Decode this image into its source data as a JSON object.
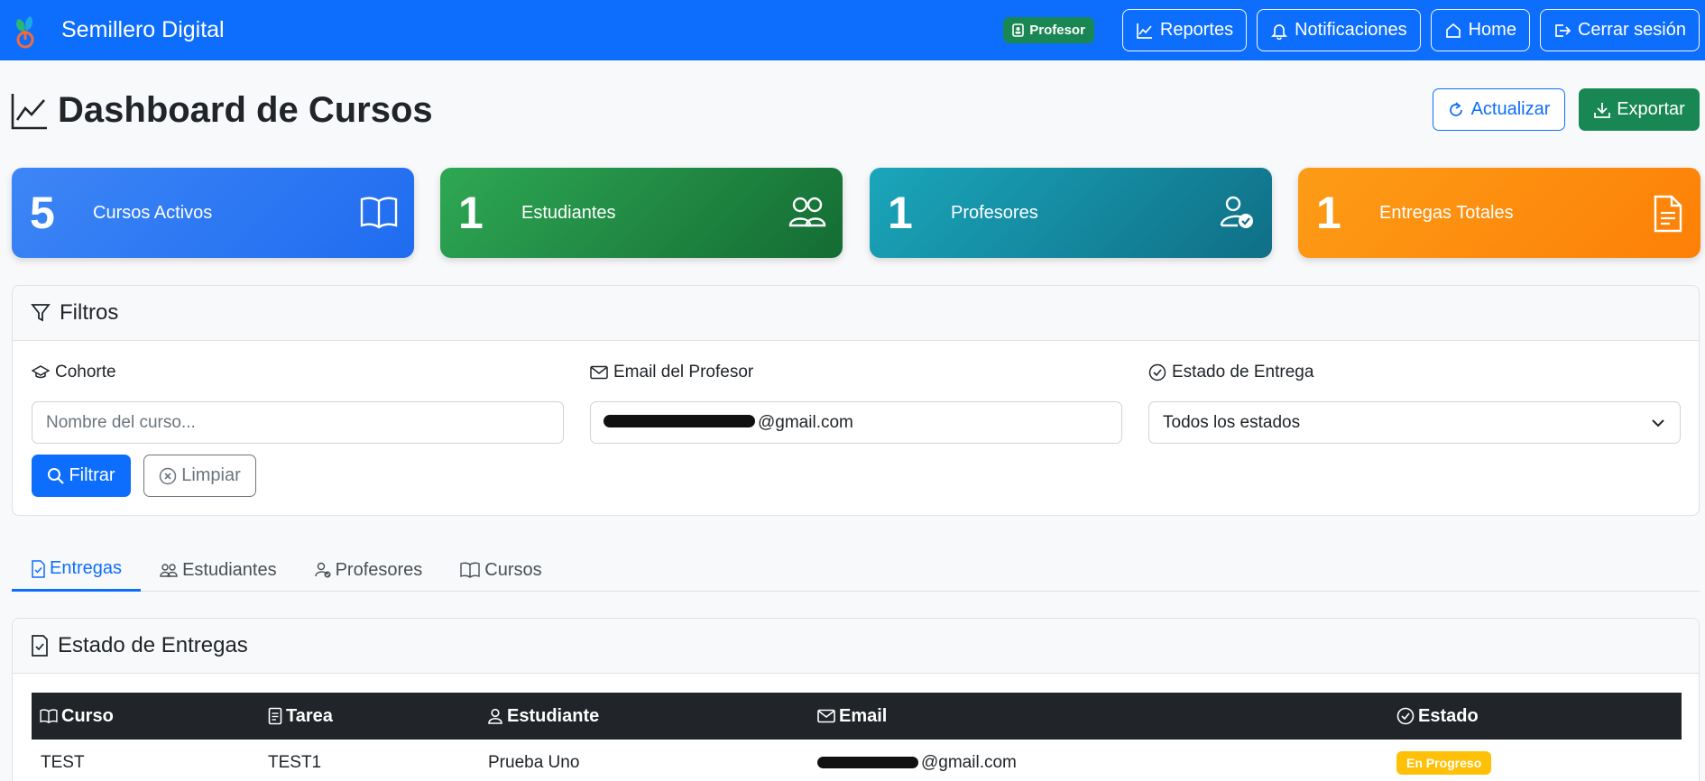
{
  "navbar": {
    "brand": "Semillero Digital",
    "role_badge": "Profesor",
    "links": [
      "Reportes",
      "Notificaciones",
      "Home",
      "Cerrar sesión"
    ]
  },
  "header": {
    "title": "Dashboard de Cursos",
    "refresh_label": "Actualizar",
    "export_label": "Exportar"
  },
  "stats": [
    {
      "value": "5",
      "label": "Cursos Activos",
      "icon": "book-icon",
      "color": "#3d86f6"
    },
    {
      "value": "1",
      "label": "Estudiantes",
      "icon": "people-icon",
      "color": "#2ea854"
    },
    {
      "value": "1",
      "label": "Profesores",
      "icon": "person-check-icon",
      "color": "#1aa6bb"
    },
    {
      "value": "1",
      "label": "Entregas Totales",
      "icon": "document-icon",
      "color": "#fd8f0f"
    }
  ],
  "filters": {
    "title": "Filtros",
    "cohorte": {
      "label": "Cohorte",
      "placeholder": "Nombre del curso..."
    },
    "email": {
      "label": "Email del Profesor",
      "value": "@gmail.com"
    },
    "estado": {
      "label": "Estado de Entrega",
      "selected": "Todos los estados"
    },
    "filter_label": "Filtrar",
    "clear_label": "Limpiar"
  },
  "tabs": [
    {
      "label": "Entregas",
      "active": true
    },
    {
      "label": "Estudiantes",
      "active": false
    },
    {
      "label": "Profesores",
      "active": false
    },
    {
      "label": "Cursos",
      "active": false
    }
  ],
  "entregas": {
    "title": "Estado de Entregas",
    "columns": [
      "Curso",
      "Tarea",
      "Estudiante",
      "Email",
      "Estado"
    ],
    "rows": [
      {
        "curso": "TEST",
        "tarea": "TEST1",
        "estudiante": "Prueba Uno",
        "email": "@gmail.com",
        "estado": "En Progreso"
      }
    ]
  },
  "colors": {
    "primary": "#0d6efd",
    "success": "#198754",
    "warning": "#ffc107",
    "dark": "#212529"
  }
}
